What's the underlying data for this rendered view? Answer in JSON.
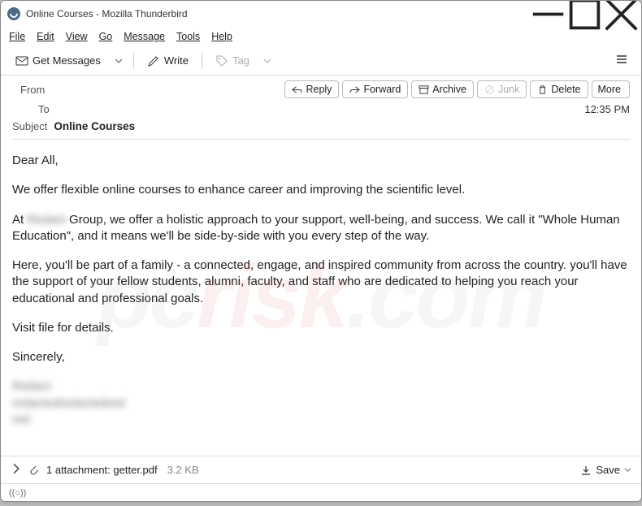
{
  "window": {
    "title": "Online Courses - Mozilla Thunderbird"
  },
  "menu": {
    "file": "File",
    "edit": "Edit",
    "view": "View",
    "go": "Go",
    "message": "Message",
    "tools": "Tools",
    "help": "Help"
  },
  "toolbar": {
    "get_messages": "Get Messages",
    "write": "Write",
    "tag": "Tag"
  },
  "header": {
    "from_label": "From",
    "to_label": "To",
    "time": "12:35 PM",
    "subject_label": "Subject",
    "subject_value": "Online Courses",
    "actions": {
      "reply": "Reply",
      "forward": "Forward",
      "archive": "Archive",
      "junk": "Junk",
      "delete": "Delete",
      "more": "More"
    }
  },
  "body": {
    "p1": "Dear All,",
    "p2": "We offer flexible online courses to enhance career and improving the scientific level.",
    "p3a": "At ",
    "p3_blur": "Redact",
    "p3b": " Group, we offer a holistic approach to your support, well-being, and success. We call it \"Whole Human Education\", and it means we'll be side-by-side with you every step of the way.",
    "p4": "Here, you'll be part of a family - a connected, engage, and inspired community from across the country. you'll have the support of your fellow students, alumni, faculty, and staff who are dedicated to helping you reach your educational and professional goals.",
    "p5": "Visit file for details.",
    "p6": "Sincerely,",
    "sig1": "Redact",
    "sig2": "redactedredactedred",
    "sig3": "red"
  },
  "attachment": {
    "count_label": "1 attachment:",
    "filename": "getter.pdf",
    "size": "3.2 KB",
    "save": "Save"
  },
  "status": {
    "indicator": "((○))"
  },
  "watermark": {
    "a": "pc",
    "b": "risk",
    "c": ".com"
  }
}
